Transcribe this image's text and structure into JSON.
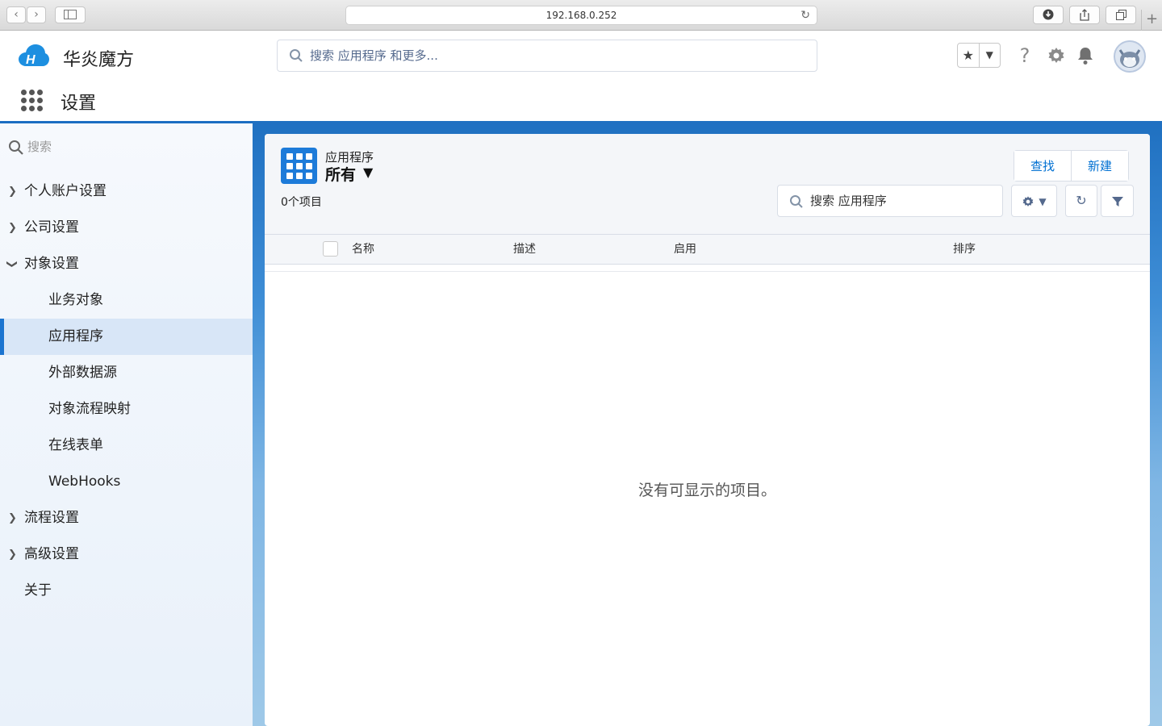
{
  "browser": {
    "url": "192.168.0.252",
    "back_icon": "chevron-left-icon",
    "forward_icon": "chevron-right-icon"
  },
  "header": {
    "brand": "华炎魔方",
    "search_placeholder": "搜索 应用程序 和更多..."
  },
  "app": {
    "title": "设置"
  },
  "sidebar": {
    "search_placeholder": "搜索",
    "items": [
      {
        "label": "个人账户设置",
        "level": 0,
        "expandable": true,
        "expanded": false
      },
      {
        "label": "公司设置",
        "level": 0,
        "expandable": true,
        "expanded": false
      },
      {
        "label": "对象设置",
        "level": 0,
        "expandable": true,
        "expanded": true
      },
      {
        "label": "业务对象",
        "level": 1
      },
      {
        "label": "应用程序",
        "level": 1,
        "active": true
      },
      {
        "label": "外部数据源",
        "level": 1
      },
      {
        "label": "对象流程映射",
        "level": 1
      },
      {
        "label": "在线表单",
        "level": 1
      },
      {
        "label": "WebHooks",
        "level": 1
      },
      {
        "label": "流程设置",
        "level": 0,
        "expandable": true,
        "expanded": false
      },
      {
        "label": "高级设置",
        "level": 0,
        "expandable": true,
        "expanded": false
      },
      {
        "label": "关于",
        "level": 0
      }
    ]
  },
  "list_view": {
    "object_type": "应用程序",
    "view_name": "所有",
    "count": "0个项目",
    "find_label": "查找",
    "new_label": "新建",
    "search_placeholder": "搜索 应用程序",
    "columns": [
      "名称",
      "描述",
      "启用",
      "排序"
    ],
    "empty_message": "没有可显示的项目。"
  },
  "colors": {
    "accent": "#1d7bd9",
    "link": "#0070d2",
    "banner": "#1f70c1"
  }
}
